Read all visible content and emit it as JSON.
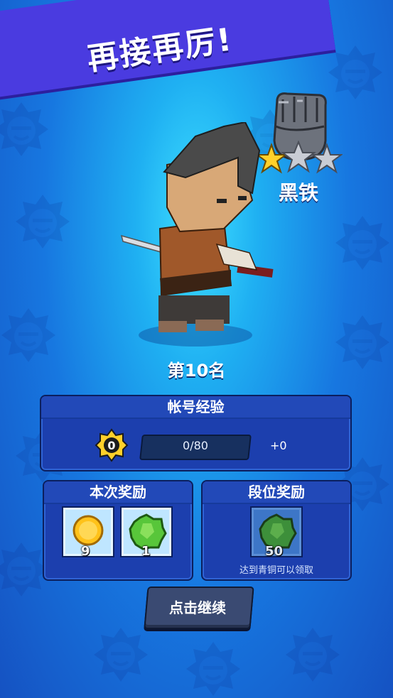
{
  "banner": {
    "title": "再接再厉!"
  },
  "rank": {
    "name": "黑铁",
    "stars_filled": 1,
    "stars_total": 3
  },
  "result": {
    "place": "第10名"
  },
  "account_xp": {
    "title": "帐号经验",
    "level": "0",
    "progress": "0/80",
    "progress_fraction": 0,
    "gain": "+0"
  },
  "match_rewards": {
    "title": "本次奖励",
    "items": [
      {
        "icon": "gold-coin-icon",
        "count": "9"
      },
      {
        "icon": "green-gem-icon",
        "count": "1"
      }
    ]
  },
  "rank_rewards": {
    "title": "段位奖励",
    "item": {
      "icon": "green-gem-icon",
      "count": "50"
    },
    "note": "达到青铜可以领取"
  },
  "continue_button": {
    "label": "点击继续"
  },
  "colors": {
    "banner": "#4a3be0",
    "panel": "#1c3fae",
    "button": "#3a4a72",
    "star_gold": "#ffd02a",
    "star_silver": "#c9ccd4"
  }
}
